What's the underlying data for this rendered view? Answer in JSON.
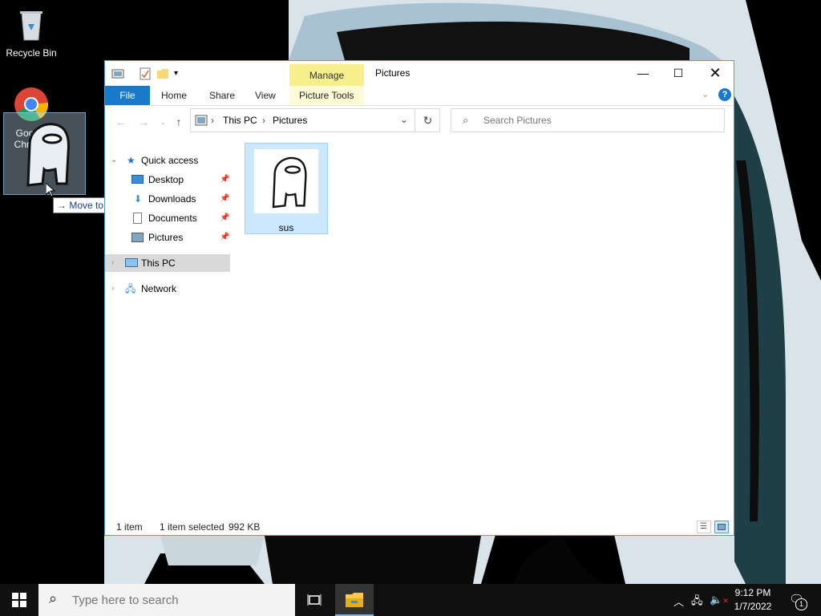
{
  "desktop": {
    "icons": [
      {
        "label": "Recycle Bin",
        "icon": "recycle-bin-icon"
      },
      {
        "label": "Google Chrome",
        "icon": "chrome-icon"
      }
    ],
    "drag_tooltip": "Move to Desktop"
  },
  "window": {
    "title": "Pictures",
    "context_tab_group": "Manage",
    "ribbon_tabs": [
      "File",
      "Home",
      "Share",
      "View",
      "Picture Tools"
    ],
    "address": {
      "segments": [
        "This PC",
        "Pictures"
      ]
    },
    "search_placeholder": "Search Pictures",
    "nav": {
      "quick_access": "Quick access",
      "quick_items": [
        "Desktop",
        "Downloads",
        "Documents",
        "Pictures"
      ],
      "this_pc": "This PC",
      "network": "Network"
    },
    "files": [
      {
        "name": "sus",
        "selected": true
      }
    ],
    "status": {
      "item_count": "1 item",
      "selection": "1 item selected",
      "size": "992 KB"
    }
  },
  "taskbar": {
    "search_placeholder": "Type here to search",
    "time": "9:12 PM",
    "date": "1/7/2022",
    "notification_count": "1"
  },
  "colors": {
    "accent": "#1979ca",
    "manage_tab": "#f8ef8e",
    "selection": "#cce8ff"
  }
}
